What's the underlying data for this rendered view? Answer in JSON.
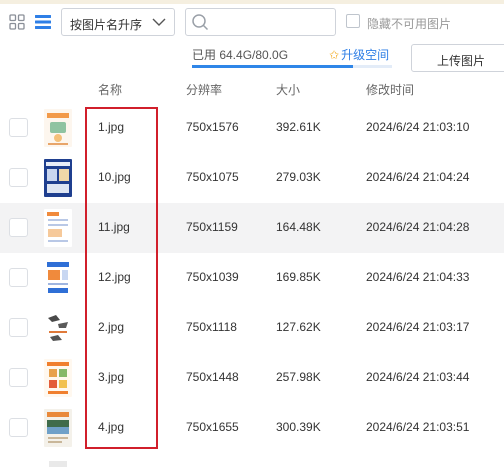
{
  "toolbar": {
    "sort_label": "按图片名升序",
    "search_placeholder": "",
    "hide_unavailable_label": "隐藏不可用图片"
  },
  "quota": {
    "used_text": "已用 64.4G/80.0G",
    "used_fraction": 0.805,
    "upgrade_label": "升级空间"
  },
  "upload_label": "上传图片",
  "columns": {
    "name": "名称",
    "resolution": "分辨率",
    "size": "大小",
    "modified": "修改时间"
  },
  "files": [
    {
      "name": "1.jpg",
      "resolution": "750x1576",
      "size": "392.61K",
      "modified": "2024/6/24 21:03:10"
    },
    {
      "name": "10.jpg",
      "resolution": "750x1075",
      "size": "279.03K",
      "modified": "2024/6/24 21:04:24"
    },
    {
      "name": "11.jpg",
      "resolution": "750x1159",
      "size": "164.48K",
      "modified": "2024/6/24 21:04:28"
    },
    {
      "name": "12.jpg",
      "resolution": "750x1039",
      "size": "169.85K",
      "modified": "2024/6/24 21:04:33"
    },
    {
      "name": "2.jpg",
      "resolution": "750x1118",
      "size": "127.62K",
      "modified": "2024/6/24 21:03:17"
    },
    {
      "name": "3.jpg",
      "resolution": "750x1448",
      "size": "257.98K",
      "modified": "2024/6/24 21:03:44"
    },
    {
      "name": "4.jpg",
      "resolution": "750x1655",
      "size": "300.39K",
      "modified": "2024/6/24 21:03:51"
    }
  ],
  "colors": {
    "accent": "#2f7fe6",
    "highlight": "#d11f2b",
    "row_hover": "#f3f3f4"
  },
  "icons": [
    "grid-view-icon",
    "list-view-icon",
    "chevron-down-icon",
    "search-icon",
    "star-icon"
  ]
}
